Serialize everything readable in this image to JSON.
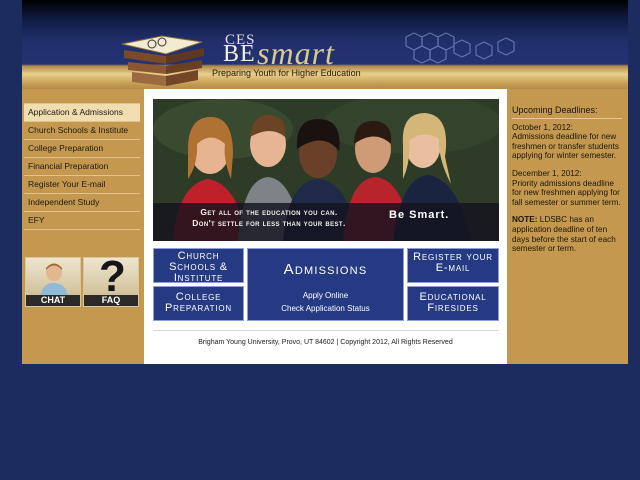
{
  "header": {
    "brand_ces": "CES",
    "brand_be": "BE",
    "brand_smart": "smart",
    "tagline": "Preparing Youth for Higher Education",
    "logo_icon": "books-icon",
    "decoration_icon": "hexagon-pattern-icon"
  },
  "left_nav": {
    "items": [
      {
        "label": "Application & Admissions"
      },
      {
        "label": "Church Schools & Institute"
      },
      {
        "label": "College Preparation"
      },
      {
        "label": "Financial Preparation"
      },
      {
        "label": "Register Your E-mail"
      },
      {
        "label": "Independent Study"
      },
      {
        "label": "EFY"
      }
    ],
    "chat_label": "CHAT",
    "faq_label": "FAQ",
    "faq_glyph": "?"
  },
  "hero": {
    "line1": "Get all of the education you can.",
    "line2": "Don't settle for less than your best.",
    "slogan": "Be Smart."
  },
  "tiles": {
    "church_line1": "Church",
    "church_line2": "Schools &",
    "church_line3": "Institute",
    "college_line1": "College",
    "college_line2": "Preparation",
    "admissions_title": "Admissions",
    "apply_online": "Apply Online",
    "check_status": "Check Application Status",
    "register_line1": "Register your",
    "register_line2": "E-mail",
    "fireside_line1": "Educational",
    "fireside_line2": "Firesides"
  },
  "footer": {
    "copyright": "Brigham Young University, Provo, UT 84602 | Copyright 2012, All Rights Reserved"
  },
  "deadlines": {
    "heading": "Upcoming Deadlines:",
    "entries": [
      {
        "date": "October 1, 2012:",
        "text": "Admissions deadline for new freshmen or transfer students applying for winter semester."
      },
      {
        "date": "December 1, 2012:",
        "text": "Priority admissions deadline for new freshmen applying for fall semester or summer term."
      }
    ],
    "note_label": "NOTE:",
    "note_text": " LDSBC has an application deadline of ten days before the start of each semester or term."
  },
  "colors": {
    "page_bg": "#1d2c5e",
    "gold": "#c4994f",
    "tile_blue": "#263a83"
  }
}
